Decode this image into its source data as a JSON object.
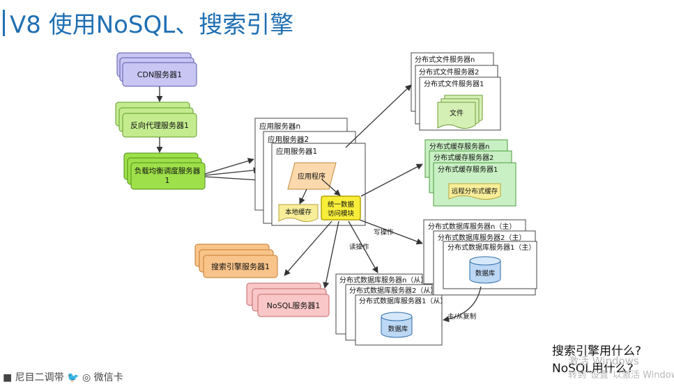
{
  "title": "V8 使用NoSQL、搜索引擎",
  "nodes": {
    "cdn": "CDN服务器1",
    "proxy": "反向代理服务器1",
    "lb_line1": "负载均衡调度服务器",
    "lb_line2": "1",
    "app_n": "应用服务器n",
    "app_2": "应用服务器2",
    "app_1": "应用服务器1",
    "app_prog": "应用程序",
    "local_cache": "本地缓存",
    "uda_line1": "统一数据",
    "uda_line2": "访问模块",
    "fs_n": "分布式文件服务器n",
    "fs_2": "分布式文件服务器2",
    "fs_1": "分布式文件服务器1",
    "file": "文件",
    "cache_n": "分布式缓存服务器n",
    "cache_2": "分布式缓存服务器2",
    "cache_1": "分布式缓存服务器1",
    "remote_cache": "远程分布式缓存",
    "db_main_n": "分布式数据库服务器n（主）",
    "db_main_2": "分布式数据库服务器2（主）",
    "db_main_1": "分布式数据库服务器1（主）",
    "db_label": "数据库",
    "db_slave_n": "分布式数据库服务器n（从）",
    "db_slave_2": "分布式数据库服务器2（从）",
    "db_slave_1": "分布式数据库服务器1（从）",
    "search": "搜索引擎服务器1",
    "nosql": "NoSQL服务器1"
  },
  "edges": {
    "write": "写操作",
    "read": "读操作",
    "replication": "主/从复制"
  },
  "questions": [
    "搜索引擎用什么?",
    "NoSQL用什么?"
  ],
  "footer": "■ 尼目二调带 🐦 ◎ 微信卡",
  "watermark": [
    "激活 Windows",
    "转到\"设置\"以激活 Windows"
  ],
  "colors": {
    "title": "#1f6fb2",
    "cdn": "#c9c6f4",
    "proxy": "#c4ec8f",
    "lb": "#9ee04a",
    "cache": "#c9f0c4",
    "search": "#f9c48a",
    "nosql": "#f9c7c7",
    "app_prog": "#fbd9ad",
    "uda": "#f8ee3a",
    "db": "#bcd8f5"
  }
}
